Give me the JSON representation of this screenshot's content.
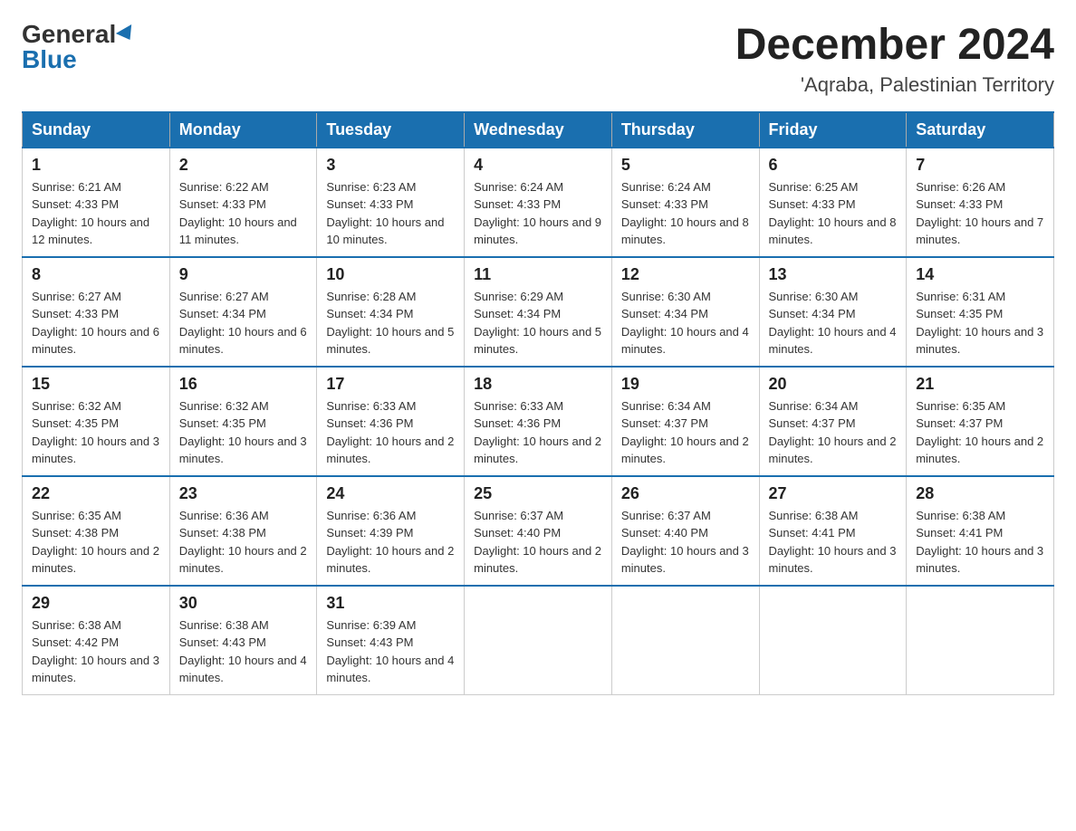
{
  "header": {
    "logo_general": "General",
    "logo_blue": "Blue",
    "month_title": "December 2024",
    "location": "'Aqraba, Palestinian Territory"
  },
  "weekdays": [
    "Sunday",
    "Monday",
    "Tuesday",
    "Wednesday",
    "Thursday",
    "Friday",
    "Saturday"
  ],
  "weeks": [
    [
      {
        "day": "1",
        "sunrise": "6:21 AM",
        "sunset": "4:33 PM",
        "daylight": "10 hours and 12 minutes."
      },
      {
        "day": "2",
        "sunrise": "6:22 AM",
        "sunset": "4:33 PM",
        "daylight": "10 hours and 11 minutes."
      },
      {
        "day": "3",
        "sunrise": "6:23 AM",
        "sunset": "4:33 PM",
        "daylight": "10 hours and 10 minutes."
      },
      {
        "day": "4",
        "sunrise": "6:24 AM",
        "sunset": "4:33 PM",
        "daylight": "10 hours and 9 minutes."
      },
      {
        "day": "5",
        "sunrise": "6:24 AM",
        "sunset": "4:33 PM",
        "daylight": "10 hours and 8 minutes."
      },
      {
        "day": "6",
        "sunrise": "6:25 AM",
        "sunset": "4:33 PM",
        "daylight": "10 hours and 8 minutes."
      },
      {
        "day": "7",
        "sunrise": "6:26 AM",
        "sunset": "4:33 PM",
        "daylight": "10 hours and 7 minutes."
      }
    ],
    [
      {
        "day": "8",
        "sunrise": "6:27 AM",
        "sunset": "4:33 PM",
        "daylight": "10 hours and 6 minutes."
      },
      {
        "day": "9",
        "sunrise": "6:27 AM",
        "sunset": "4:34 PM",
        "daylight": "10 hours and 6 minutes."
      },
      {
        "day": "10",
        "sunrise": "6:28 AM",
        "sunset": "4:34 PM",
        "daylight": "10 hours and 5 minutes."
      },
      {
        "day": "11",
        "sunrise": "6:29 AM",
        "sunset": "4:34 PM",
        "daylight": "10 hours and 5 minutes."
      },
      {
        "day": "12",
        "sunrise": "6:30 AM",
        "sunset": "4:34 PM",
        "daylight": "10 hours and 4 minutes."
      },
      {
        "day": "13",
        "sunrise": "6:30 AM",
        "sunset": "4:34 PM",
        "daylight": "10 hours and 4 minutes."
      },
      {
        "day": "14",
        "sunrise": "6:31 AM",
        "sunset": "4:35 PM",
        "daylight": "10 hours and 3 minutes."
      }
    ],
    [
      {
        "day": "15",
        "sunrise": "6:32 AM",
        "sunset": "4:35 PM",
        "daylight": "10 hours and 3 minutes."
      },
      {
        "day": "16",
        "sunrise": "6:32 AM",
        "sunset": "4:35 PM",
        "daylight": "10 hours and 3 minutes."
      },
      {
        "day": "17",
        "sunrise": "6:33 AM",
        "sunset": "4:36 PM",
        "daylight": "10 hours and 2 minutes."
      },
      {
        "day": "18",
        "sunrise": "6:33 AM",
        "sunset": "4:36 PM",
        "daylight": "10 hours and 2 minutes."
      },
      {
        "day": "19",
        "sunrise": "6:34 AM",
        "sunset": "4:37 PM",
        "daylight": "10 hours and 2 minutes."
      },
      {
        "day": "20",
        "sunrise": "6:34 AM",
        "sunset": "4:37 PM",
        "daylight": "10 hours and 2 minutes."
      },
      {
        "day": "21",
        "sunrise": "6:35 AM",
        "sunset": "4:37 PM",
        "daylight": "10 hours and 2 minutes."
      }
    ],
    [
      {
        "day": "22",
        "sunrise": "6:35 AM",
        "sunset": "4:38 PM",
        "daylight": "10 hours and 2 minutes."
      },
      {
        "day": "23",
        "sunrise": "6:36 AM",
        "sunset": "4:38 PM",
        "daylight": "10 hours and 2 minutes."
      },
      {
        "day": "24",
        "sunrise": "6:36 AM",
        "sunset": "4:39 PM",
        "daylight": "10 hours and 2 minutes."
      },
      {
        "day": "25",
        "sunrise": "6:37 AM",
        "sunset": "4:40 PM",
        "daylight": "10 hours and 2 minutes."
      },
      {
        "day": "26",
        "sunrise": "6:37 AM",
        "sunset": "4:40 PM",
        "daylight": "10 hours and 3 minutes."
      },
      {
        "day": "27",
        "sunrise": "6:38 AM",
        "sunset": "4:41 PM",
        "daylight": "10 hours and 3 minutes."
      },
      {
        "day": "28",
        "sunrise": "6:38 AM",
        "sunset": "4:41 PM",
        "daylight": "10 hours and 3 minutes."
      }
    ],
    [
      {
        "day": "29",
        "sunrise": "6:38 AM",
        "sunset": "4:42 PM",
        "daylight": "10 hours and 3 minutes."
      },
      {
        "day": "30",
        "sunrise": "6:38 AM",
        "sunset": "4:43 PM",
        "daylight": "10 hours and 4 minutes."
      },
      {
        "day": "31",
        "sunrise": "6:39 AM",
        "sunset": "4:43 PM",
        "daylight": "10 hours and 4 minutes."
      },
      null,
      null,
      null,
      null
    ]
  ]
}
